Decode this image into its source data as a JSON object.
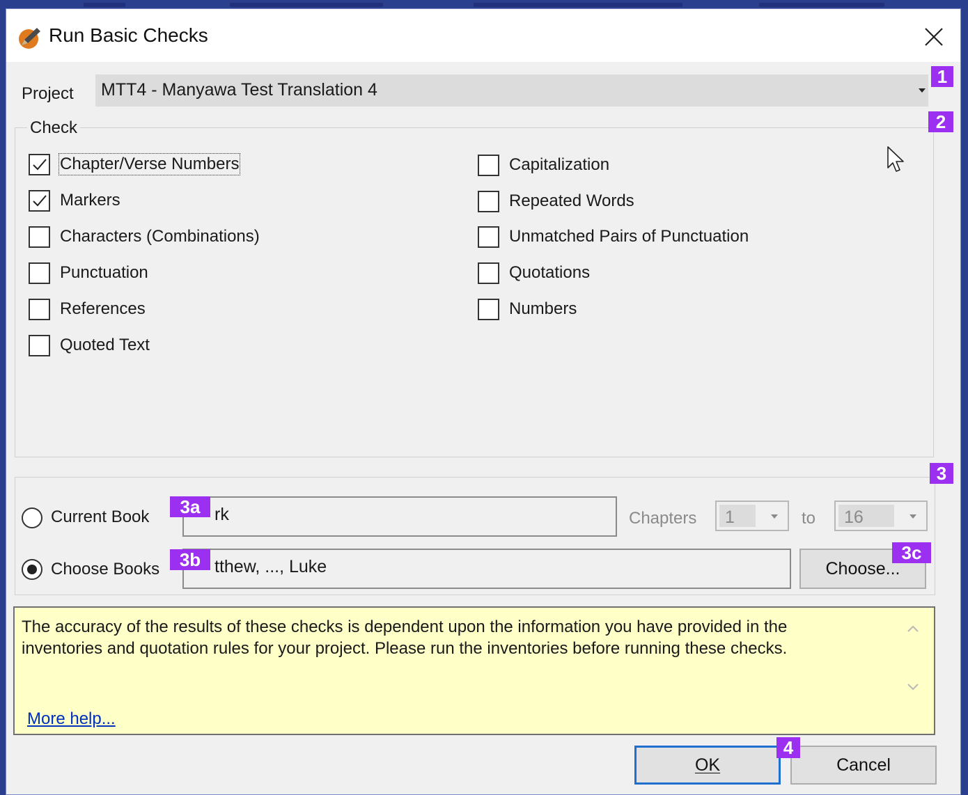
{
  "window": {
    "title": "Run Basic Checks",
    "close_icon": "close-icon",
    "app_icon": "pencil-badge-icon"
  },
  "project": {
    "label": "Project",
    "selected": "MTT4 -  Manyawa Test Translation 4"
  },
  "check_group": {
    "legend": "Check",
    "left": [
      {
        "label": "Chapter/Verse Numbers",
        "checked": true
      },
      {
        "label": "Markers",
        "checked": true
      },
      {
        "label": "Characters (Combinations)",
        "checked": false
      },
      {
        "label": "Punctuation",
        "checked": false
      },
      {
        "label": "References",
        "checked": false
      },
      {
        "label": "Quoted Text",
        "checked": false
      }
    ],
    "right": [
      {
        "label": "Capitalization",
        "checked": false
      },
      {
        "label": "Repeated Words",
        "checked": false
      },
      {
        "label": "Unmatched Pairs of Punctuation",
        "checked": false
      },
      {
        "label": "Quotations",
        "checked": false
      },
      {
        "label": "Numbers",
        "checked": false
      }
    ]
  },
  "scope": {
    "current_book_label": "Current Book",
    "current_book_value": "rk",
    "chapters_label": "Chapters",
    "chapter_from": "1",
    "to_label": "to",
    "chapter_to": "16",
    "choose_books_label": "Choose Books",
    "choose_books_value": "tthew, ..., Luke",
    "choose_button": "Choose...",
    "selected_option": "choose_books"
  },
  "info": {
    "message": "The accuracy of the results of these checks is dependent upon the information you have provided in the inventories and quotation rules for your project. Please run the inventories before running these checks.",
    "more_help": "More help..."
  },
  "buttons": {
    "ok": "OK",
    "cancel": "Cancel"
  },
  "annotations": {
    "b1": "1",
    "b2": "2",
    "b3": "3",
    "b3a": "3a",
    "b3b": "3b",
    "b3c": "3c",
    "b4": "4"
  },
  "colors": {
    "badge": "#9b30f0",
    "info_bg": "#ffffc8",
    "link": "#0030c0",
    "default_button_border": "#1f6fd0"
  }
}
